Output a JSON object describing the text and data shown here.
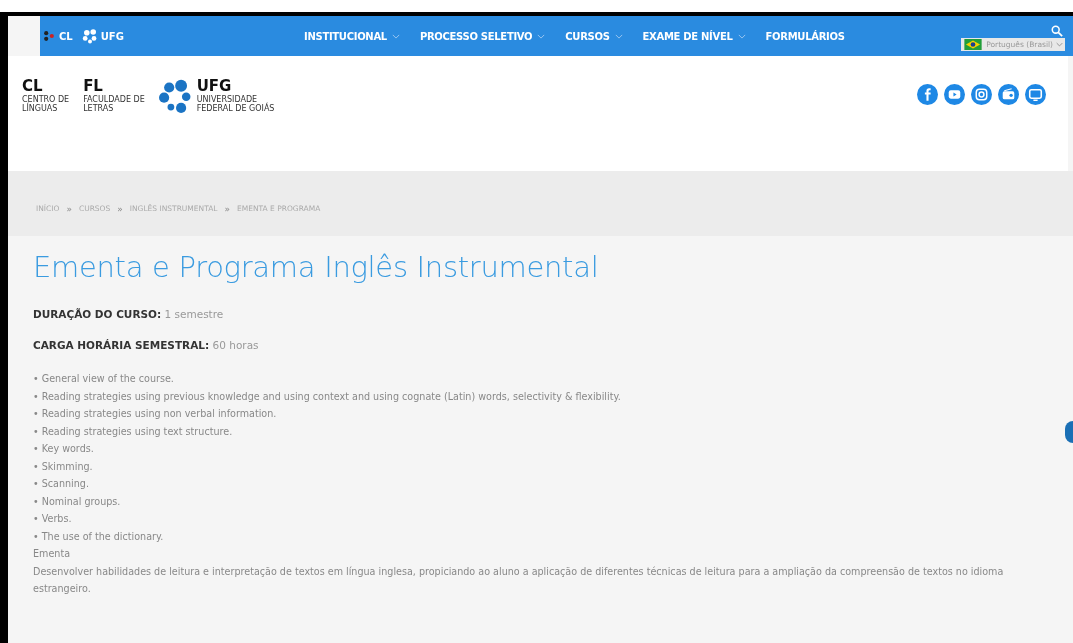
{
  "navbar": {
    "logo": {
      "cl": "CL",
      "ufg": "UFG"
    },
    "items": [
      {
        "label": "INSTITUCIONAL",
        "dropdown": true
      },
      {
        "label": "PROCESSO SELETIVO",
        "dropdown": true
      },
      {
        "label": "CURSOS",
        "dropdown": true
      },
      {
        "label": "EXAME DE NÍVEL",
        "dropdown": true
      },
      {
        "label": "FORMULÁRIOS",
        "dropdown": false
      }
    ],
    "language": "Português (Brasil)"
  },
  "header": {
    "logos": [
      {
        "kind": "text",
        "title": "CL",
        "subtitle": [
          "CENTRO DE",
          "LÍNGUAS"
        ]
      },
      {
        "kind": "text",
        "title": "FL",
        "subtitle": [
          "FACULDADE DE",
          "LETRAS"
        ]
      },
      {
        "kind": "ufg",
        "title": "UFG",
        "subtitle": [
          "UNIVERSIDADE",
          "FEDERAL DE GOIÁS"
        ]
      }
    ],
    "social": [
      {
        "kind": "facebook"
      },
      {
        "kind": "youtube"
      },
      {
        "kind": "instagram"
      },
      {
        "kind": "radio"
      },
      {
        "kind": "tv"
      }
    ]
  },
  "breadcrumb": [
    "INÍCIO",
    "CURSOS",
    "INGLÊS INSTRUMENTAL",
    "EMENTA E PROGRAMA"
  ],
  "breadcrumb_separator": "»",
  "title": "Ementa e Programa Inglês Instrumental",
  "fields": [
    {
      "label": "DURAÇÃO DO CURSO:",
      "value": "1 semestre"
    },
    {
      "label": "CARGA HORÁRIA SEMESTRAL:",
      "value": "60 horas"
    }
  ],
  "bullet": "•",
  "topics": [
    "General view of the course.",
    "Reading strategies using previous knowledge and using context and using cognate (Latin) words, selectivity & flexibility.",
    "Reading strategies using non verbal information.",
    "Reading strategies using text structure.",
    "Key words.",
    "Skimming.",
    "Scanning.",
    "Nominal groups.",
    "Verbs.",
    "The use of the dictionary."
  ],
  "ementa": {
    "heading": "Ementa",
    "text": "Desenvolver habilidades de leitura e interpretação de textos em língua inglesa, propiciando ao aluno a aplicação de diferentes técnicas de leitura para a ampliação da compreensão de textos no idioma estrangeiro."
  }
}
